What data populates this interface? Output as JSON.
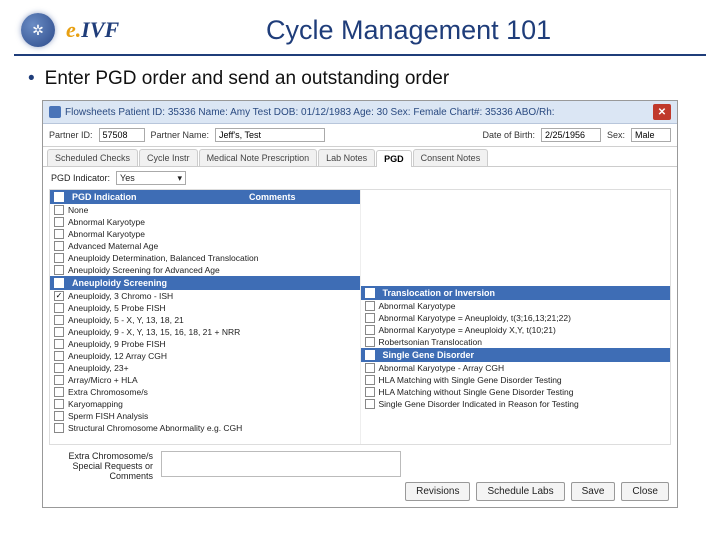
{
  "slide": {
    "title": "Cycle Management 101",
    "bullet": "Enter PGD order and send an outstanding order",
    "logo_text_e": "e.",
    "logo_text_ivf": "IVF"
  },
  "window": {
    "title": "Flowsheets  Patient ID: 35336   Name: Amy Test   DOB: 01/12/1983   Age: 30   Sex: Female   Chart#: 35336  ABO/Rh:"
  },
  "partner": {
    "id_label": "Partner ID:",
    "id_value": "57508",
    "name_label": "Partner Name:",
    "name_value": "Jeff's, Test",
    "dob_label": "Date of Birth:",
    "dob_value": "2/25/1956",
    "sex_label": "Sex:",
    "sex_value": "Male"
  },
  "tabs": [
    {
      "label": "Scheduled Checks"
    },
    {
      "label": "Cycle Instr"
    },
    {
      "label": "Medical Note Prescription"
    },
    {
      "label": "Lab Notes"
    },
    {
      "label": "PGD",
      "active": true
    },
    {
      "label": "Consent Notes"
    }
  ],
  "subbar": {
    "label": "PGD Indicator:",
    "value": "Yes"
  },
  "left_groups": [
    {
      "header": "PGD Indication",
      "comments_header": "Comments",
      "items": [
        {
          "label": "None"
        },
        {
          "label": "Abnormal Karyotype"
        },
        {
          "label": "Abnormal Karyotype"
        },
        {
          "label": "Advanced Maternal Age"
        },
        {
          "label": "Aneuploidy Determination, Balanced Translocation"
        },
        {
          "label": "Aneuploidy Screening for Advanced Age"
        }
      ]
    },
    {
      "header": "Aneuploidy Screening",
      "items": [
        {
          "label": "Aneuploidy, 3 Chromo - ISH",
          "checked": true
        },
        {
          "label": "Aneuploidy, 5 Probe FISH"
        },
        {
          "label": "Aneuploidy, 5 - X, Y, 13, 18, 21"
        },
        {
          "label": "Aneuploidy, 9 - X, Y, 13, 15, 16, 18, 21 + NRR"
        },
        {
          "label": "Aneuploidy, 9 Probe FISH"
        },
        {
          "label": "Aneuploidy, 12 Array CGH"
        },
        {
          "label": "Aneuploidy, 23+"
        },
        {
          "label": "Array/Micro + HLA"
        },
        {
          "label": "Extra Chromosome/s"
        },
        {
          "label": "Karyomapping"
        },
        {
          "label": "Sperm FISH Analysis"
        },
        {
          "label": "Structural Chromosome Abnormality e.g. CGH"
        }
      ]
    }
  ],
  "right_groups": [
    {
      "header": "Translocation or Inversion",
      "items": [
        {
          "label": "Abnormal Karyotype"
        },
        {
          "label": "Abnormal Karyotype = Aneuploidy, t(3;16,13;21;22)"
        },
        {
          "label": "Abnormal Karyotype = Aneuploidy X,Y, t(10;21)"
        },
        {
          "label": "Robertsonian Translocation"
        }
      ]
    },
    {
      "header": "Single Gene Disorder",
      "items": [
        {
          "label": "Abnormal Karyotype - Array CGH"
        },
        {
          "label": "HLA Matching with Single Gene Disorder Testing"
        },
        {
          "label": "HLA Matching without Single Gene Disorder Testing"
        },
        {
          "label": "Single Gene Disorder Indicated in Reason for Testing"
        }
      ]
    }
  ],
  "extras": {
    "label1": "Extra Chromosome/s",
    "label2": "Special Requests or Comments"
  },
  "buttons": {
    "revisions": "Revisions",
    "schedule": "Schedule Labs",
    "save": "Save",
    "close": "Close"
  }
}
